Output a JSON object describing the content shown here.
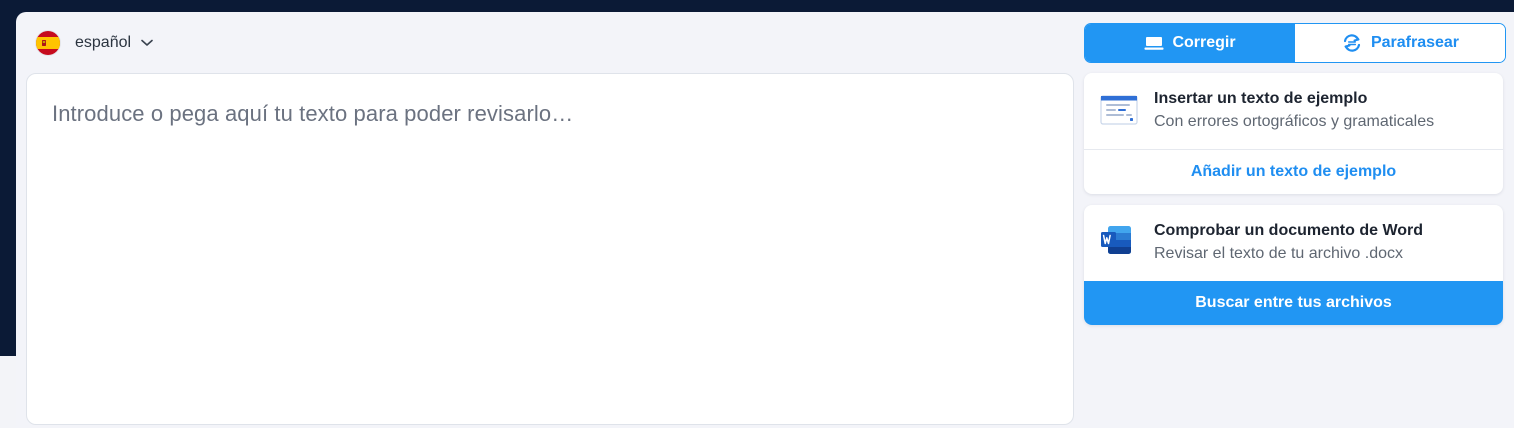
{
  "language": {
    "label": "español",
    "flag_icon": "spain-flag-icon",
    "chevron_icon": "chevron-down-icon"
  },
  "editor": {
    "placeholder": "Introduce o pega aquí tu texto para poder revisarlo…"
  },
  "mode_toggle": {
    "correct_label": "Corregir",
    "correct_icon": "laptop-icon",
    "paraphrase_label": "Parafrasear",
    "paraphrase_icon": "rephrase-cycle-icon",
    "active": "correct"
  },
  "cards": {
    "example": {
      "icon": "document-sample-icon",
      "title": "Insertar un texto de ejemplo",
      "subtitle": "Con errores ortográficos y gramaticales",
      "action_label": "Añadir un texto de ejemplo"
    },
    "word": {
      "icon": "word-icon",
      "title": "Comprobar un documento de Word",
      "subtitle": "Revisar el texto de tu archivo .docx",
      "action_label": "Buscar entre tus archivos"
    }
  },
  "colors": {
    "accent": "#2196f3",
    "background_dark": "#0b1a36",
    "panel": "#f3f4f9"
  }
}
